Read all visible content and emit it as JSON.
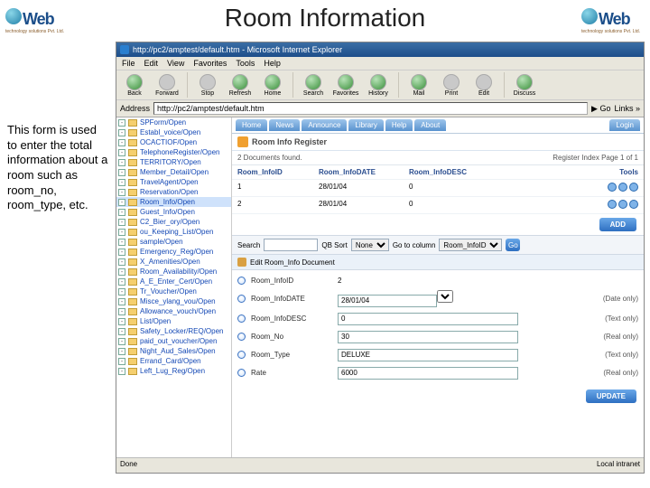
{
  "slide": {
    "title": "Room Information",
    "left_text": "This form is used to enter the total information about a room such as room_no, room_type, etc.",
    "logo_text": "Web",
    "logo_sub": "technology solutions Pvt. Ltd."
  },
  "window": {
    "title": "http://pc2/amptest/default.htm - Microsoft Internet Explorer",
    "menus": [
      "File",
      "Edit",
      "View",
      "Favorites",
      "Tools",
      "Help"
    ]
  },
  "toolbar": {
    "back": "Back",
    "forward": "Forward",
    "stop": "Stop",
    "refresh": "Refresh",
    "home": "Home",
    "search": "Search",
    "favorites": "Favorites",
    "history": "History",
    "mail": "Mail",
    "print": "Print",
    "edit": "Edit",
    "discuss": "Discuss"
  },
  "address": {
    "label": "Address",
    "value": "http://pc2/amptest/default.htm",
    "go": "Go",
    "links": "Links »"
  },
  "tree": {
    "items": [
      "SPForm/Open",
      "Establ_voice/Open",
      "OCACTIOF/Open",
      "TelephoneRegister/Open",
      "TERRITORY/Open",
      "Member_Detail/Open",
      "TravelAgent/Open",
      "Reservation/Open",
      "Room_Info/Open",
      "Guest_Info/Open",
      "C2_Bier_ory/Open",
      "ou_Keeping_List/Open",
      "sample/Open",
      "Emergency_Reg/Open",
      "X_Amenities/Open",
      "Room_Availability/Open",
      "A_E_Enter_Cert/Open",
      "Tr_Voucher/Open",
      "Misce_ylang_vou/Open",
      "Allowance_vouch/Open",
      "List/Open",
      "Safety_Locker/REQ/Open",
      "paid_out_voucher/Open",
      "Night_Aud_Sales/Open",
      "Errand_Card/Open",
      "Left_Lug_Reg/Open"
    ],
    "selected_index": 8
  },
  "tabs": [
    "Home",
    "News",
    "Announce",
    "Library",
    "Help",
    "About",
    "Login"
  ],
  "section": {
    "title": "Room Info Register"
  },
  "docbar": {
    "left": "2 Documents found.",
    "right": "Register Index Page 1 of 1"
  },
  "grid": {
    "headers": [
      "Room_InfoID",
      "Room_InfoDATE",
      "Room_InfoDESC",
      "Tools"
    ],
    "rows": [
      {
        "id": "1",
        "date": "28/01/04",
        "desc": "0"
      },
      {
        "id": "2",
        "date": "28/01/04",
        "desc": "0"
      }
    ]
  },
  "buttons": {
    "add": "ADD",
    "update": "UPDATE",
    "go": "Go",
    "gocolumn": "Go to column"
  },
  "search": {
    "label": "Search",
    "qbsort_label": "QB Sort",
    "none": "None",
    "column": "Room_InfoID"
  },
  "editsec": {
    "title": "Edit Room_Info Document"
  },
  "form": {
    "fields": [
      {
        "label": "Room_InfoID",
        "value": "2",
        "hint": ""
      },
      {
        "label": "Room_InfoDATE",
        "value": "28/01/04",
        "hint": "(Date only)"
      },
      {
        "label": "Room_InfoDESC",
        "value": "0",
        "hint": "(Text only)"
      },
      {
        "label": "Room_No",
        "value": "30",
        "hint": "(Real only)"
      },
      {
        "label": "Room_Type",
        "value": "DELUXE",
        "hint": "(Text only)"
      },
      {
        "label": "Rate",
        "value": "6000",
        "hint": "(Real only)"
      }
    ]
  },
  "statusbar": {
    "left": "Done",
    "right": "Local intranet"
  }
}
